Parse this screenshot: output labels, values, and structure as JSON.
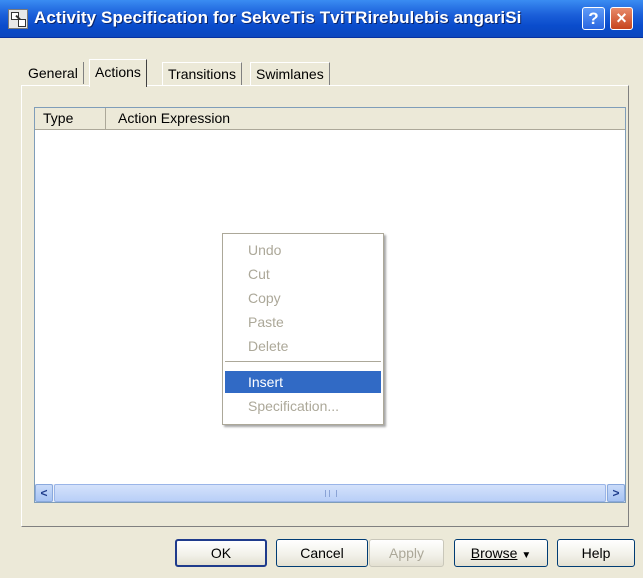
{
  "window": {
    "title": "Activity Specification for SekveTis TviTRirebulebis angariSi",
    "help_label": "?",
    "close_label": "×"
  },
  "tabs": [
    {
      "label": "General",
      "active": false
    },
    {
      "label": "Actions",
      "active": true
    },
    {
      "label": "Transitions",
      "active": false
    },
    {
      "label": "Swimlanes",
      "active": false
    }
  ],
  "list": {
    "columns": [
      "Type",
      "Action Expression"
    ],
    "rows": []
  },
  "scrollbar": {
    "left_arrow": "<",
    "right_arrow": ">"
  },
  "context_menu": {
    "items": [
      {
        "label": "Undo",
        "enabled": false
      },
      {
        "label": "Cut",
        "enabled": false
      },
      {
        "label": "Copy",
        "enabled": false
      },
      {
        "label": "Paste",
        "enabled": false
      },
      {
        "label": "Delete",
        "enabled": false
      },
      {
        "label": "Insert",
        "enabled": true,
        "highlighted": true
      },
      {
        "label": "Specification...",
        "enabled": false
      }
    ]
  },
  "buttons": {
    "ok": "OK",
    "cancel": "Cancel",
    "apply": "Apply",
    "browse": "Browse",
    "browse_arrow": "▼",
    "help": "Help"
  },
  "colors": {
    "titlebar": "#0a4ccc",
    "dialog_bg": "#ece9d8",
    "menu_highlight": "#316ac5"
  }
}
